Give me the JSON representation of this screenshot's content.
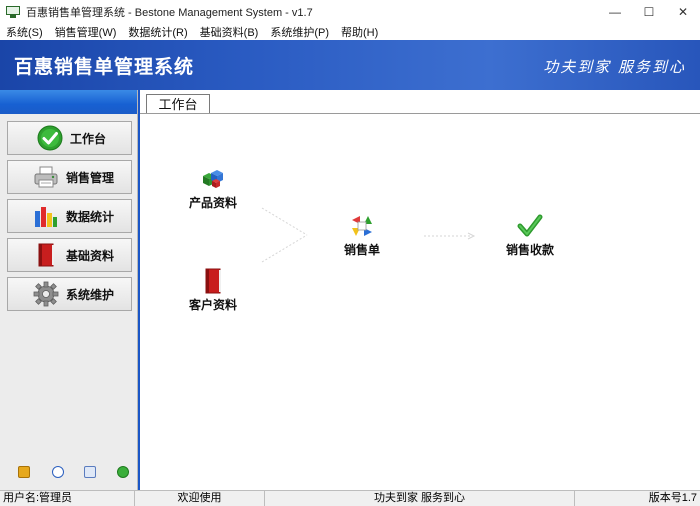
{
  "window": {
    "title": "百惠销售单管理系统 - Bestone Management System - v1.7",
    "controls": {
      "minimize": "—",
      "maximize": "☐",
      "close": "✕"
    }
  },
  "menu": [
    {
      "label": "系统(S)"
    },
    {
      "label": "销售管理(W)"
    },
    {
      "label": "数据统计(R)"
    },
    {
      "label": "基础资料(B)"
    },
    {
      "label": "系统维护(P)"
    },
    {
      "label": "帮助(H)"
    }
  ],
  "header": {
    "title": "百惠销售单管理系统",
    "slogan": "功夫到家 服务到心"
  },
  "sidebar": {
    "items": [
      {
        "label": "工作台",
        "icon": "check-circle-icon"
      },
      {
        "label": "销售管理",
        "icon": "printer-icon"
      },
      {
        "label": "数据统计",
        "icon": "bar-chart-icon"
      },
      {
        "label": "基础资料",
        "icon": "book-icon"
      },
      {
        "label": "系统维护",
        "icon": "gear-icon"
      }
    ],
    "bottom_icons": [
      "edit-icon",
      "clock-icon",
      "search-icon",
      "exit-icon"
    ]
  },
  "tab": {
    "label": "工作台"
  },
  "workflow": {
    "product": {
      "label": "产品资料",
      "icon": "product-cubes-icon"
    },
    "customer": {
      "label": "客户资料",
      "icon": "customer-book-icon"
    },
    "sales_order": {
      "label": "销售单",
      "icon": "sales-order-icon"
    },
    "collection": {
      "label": "销售收款",
      "icon": "checkmark-icon"
    }
  },
  "status": {
    "user": "用户名:管理员",
    "welcome": "欢迎使用",
    "slogan": "功夫到家 服务到心",
    "version": "版本号1.7"
  },
  "colors": {
    "header_blue": "#2a5bc2",
    "active_green": "#2ea02e",
    "border_blue": "#1a56c6"
  }
}
